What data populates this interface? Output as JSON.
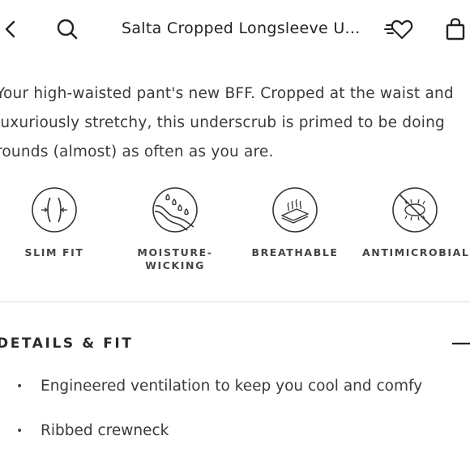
{
  "header": {
    "title": "Salta Cropped Longsleeve U...",
    "icons": [
      "back-chevron",
      "search",
      "wishlist-heart",
      "shopping-bag"
    ]
  },
  "description": {
    "lines": [
      "Your high-waisted pant's new BFF. Cropped at the waist and",
      "luxuriously stretchy, this underscrub is primed to be doing",
      "rounds (almost) as often as you are."
    ]
  },
  "features": [
    {
      "label": "SLIM FIT",
      "icon": "slim-fit"
    },
    {
      "label": "MOISTURE-\nWICKING",
      "icon": "moisture-wicking"
    },
    {
      "label": "BREATHABLE",
      "icon": "breathable"
    },
    {
      "label": "ANTIMICROBIAL",
      "icon": "antimicrobial"
    }
  ],
  "details": {
    "title": "DETAILS & FIT",
    "toggle": "collapse",
    "bullets": [
      "Engineered ventilation to keep you cool and comfy",
      "Ribbed crewneck"
    ]
  }
}
